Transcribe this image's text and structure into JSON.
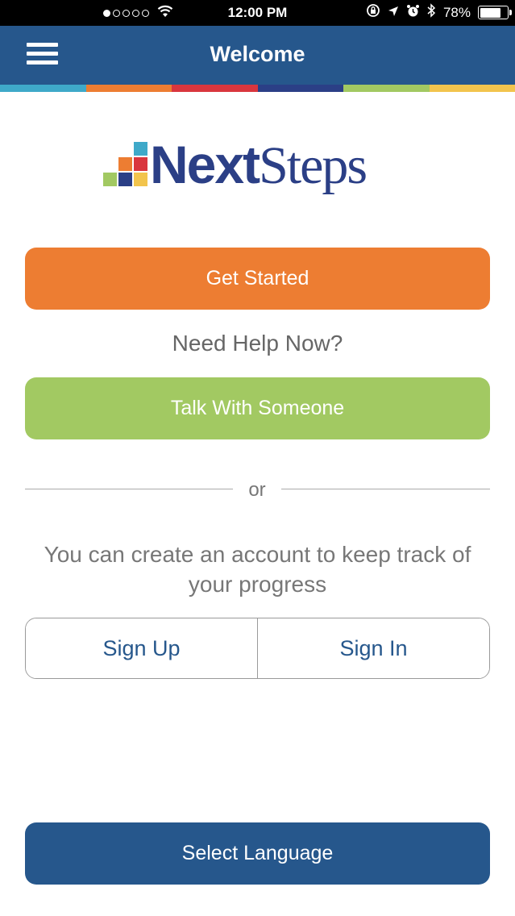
{
  "status_bar": {
    "time": "12:00 PM",
    "battery": "78%",
    "battery_level": 0.78,
    "signal_bars": 1,
    "signal_total": 5,
    "icons": [
      "wifi-icon",
      "rotation-lock-icon",
      "location-icon",
      "alarm-icon",
      "bluetooth-icon"
    ]
  },
  "nav": {
    "title": "Welcome",
    "menu_icon": "hamburger-menu-icon",
    "strip_colors": [
      "#3fa9c9",
      "#ed7d32",
      "#d9363e",
      "#2b3f86",
      "#a2c962",
      "#f2c44d"
    ]
  },
  "logo": {
    "part1": "Next",
    "part2": "Steps",
    "block_colors": [
      "#3fa9c9",
      "#ed7d32",
      "#d9363e",
      "#2b3f86",
      "#a2c962",
      "#f2c44d"
    ]
  },
  "main": {
    "get_started_label": "Get Started",
    "help_text": "Need Help Now?",
    "talk_label": "Talk With Someone",
    "divider_text": "or",
    "account_text": "You can create an account to keep track of your progress",
    "sign_up_label": "Sign Up",
    "sign_in_label": "Sign In",
    "select_language_label": "Select Language"
  },
  "colors": {
    "primary": "#26578c",
    "orange": "#ed7d32",
    "green": "#a2c962"
  }
}
